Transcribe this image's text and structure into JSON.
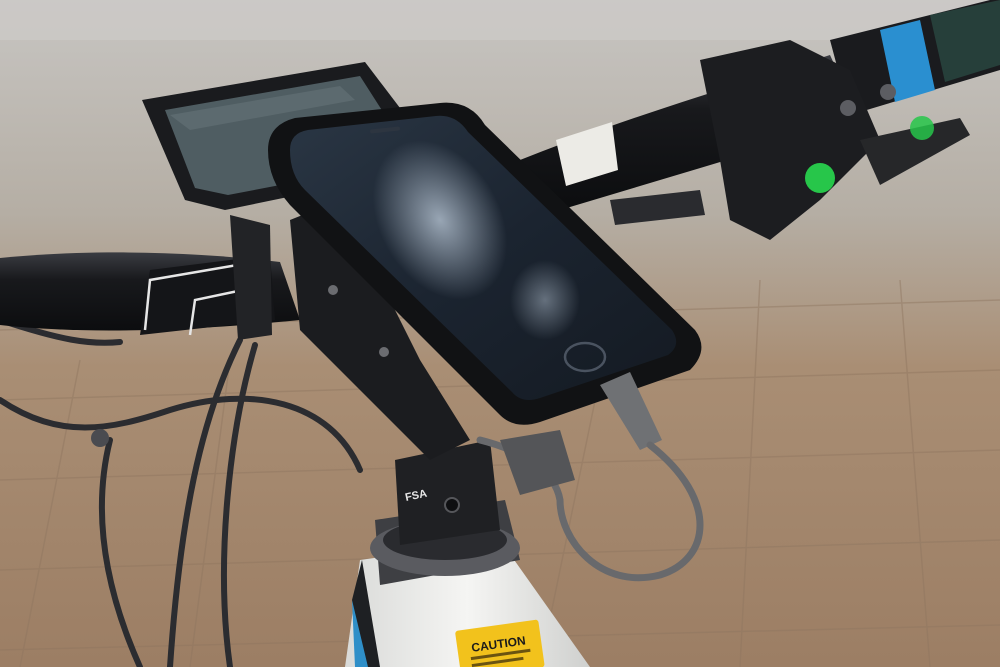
{
  "photo": {
    "labels": {
      "caution_sticker": "CAUTION",
      "stem_brand": "FSA"
    },
    "colors": {
      "road": "#b8b3aa",
      "pavement": "#a88c70",
      "bar": "#16171a",
      "phone_screen": "#1d2733",
      "display_screen": "#4f5d62",
      "frame": "#f1f1ee",
      "frame_stripe": "#2f8fc8",
      "caution_yellow": "#f2c21c",
      "grip_accent": "#2a8fd0",
      "indicator_green": "#27c64a"
    }
  }
}
